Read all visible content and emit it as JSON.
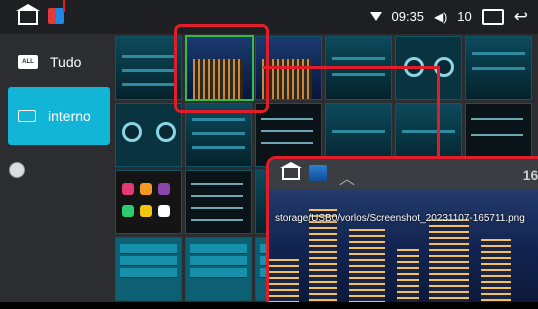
{
  "status_bar": {
    "time": "09:35",
    "volume": "10"
  },
  "sidebar": {
    "items": [
      {
        "icon_text": "ALL",
        "label": "Tudo"
      },
      {
        "label": "interno"
      }
    ]
  },
  "preview": {
    "time": "16:",
    "path": "storage/USB0/vorlos/Screenshot_20231107-165711.png"
  },
  "colors": {
    "accent": "#13b5d6",
    "highlight": "#e11d2a",
    "selected_border": "#2fbf48"
  },
  "icons": [
    "home-icon",
    "gallery-app-icon",
    "wifi-icon",
    "volume-icon",
    "recent-apps-icon",
    "back-icon",
    "folder-icon",
    "up-arrow-icon"
  ]
}
